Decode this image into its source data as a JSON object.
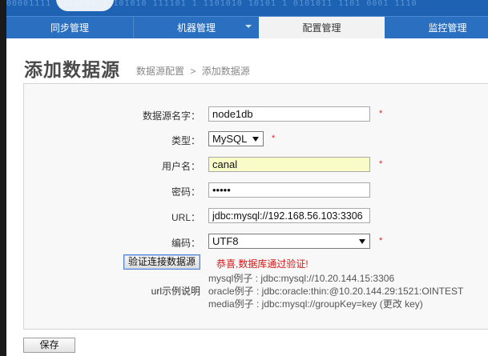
{
  "banner": {
    "bits": "00001111 1111000 1 101010 111101 1 1101010 10101 1 0101011 1101 0001 1110"
  },
  "nav": {
    "items": [
      {
        "label": "同步管理"
      },
      {
        "label": "机器管理"
      },
      {
        "label": "配置管理"
      },
      {
        "label": "监控管理"
      }
    ],
    "active_index": 2
  },
  "page": {
    "title": "添加数据源",
    "breadcrumb": [
      "数据源配置",
      ">",
      "添加数据源"
    ]
  },
  "form": {
    "name_label": "数据源名字：",
    "name_value": "node1db",
    "type_label": "类型：",
    "type_value": "MySQL",
    "user_label": "用户名：",
    "user_value": "canal",
    "password_label": "密码：",
    "password_value": "•••••",
    "url_label": "URL：",
    "url_value": "jdbc:mysql://192.168.56.103:3306",
    "encoding_label": "编码：",
    "encoding_value": "UTF8",
    "required_mark": "*",
    "verify_button": "验证连接数据源",
    "verify_message": "恭喜,数据库通过验证!",
    "url_example_label": "url示例说明",
    "examples": [
      "mysql例子 : jdbc:mysql://10.20.144.15:3306",
      "oracle例子 : jdbc:oracle:thin:@10.20.144.29:1521:OINTEST",
      "media例子 : jdbc:mysql://groupKey=key (更改 key)"
    ]
  },
  "footer": {
    "save_button": "保存"
  },
  "colors": {
    "nav_bg": "#2a6fc0",
    "banner_bg": "#1e63b3",
    "required": "#e02020",
    "success": "#d61515"
  }
}
